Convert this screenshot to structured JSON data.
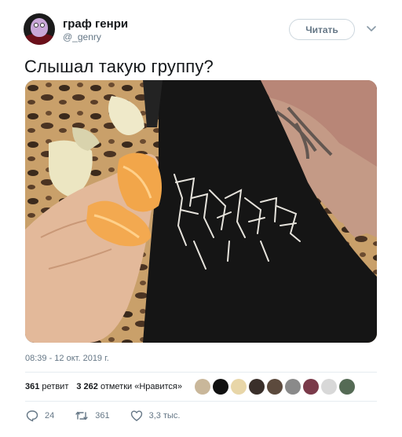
{
  "author": {
    "display_name": "граф генри",
    "handle": "@_genry"
  },
  "follow_button_label": "Читать",
  "tweet_text": "Слышал такую группу?",
  "timestamp": "08:39 - 12 окт. 2019 г.",
  "stats": {
    "retweets_count": "361",
    "retweets_label": "ретвит",
    "likes_count": "3 262",
    "likes_label": "отметки «Нравится»"
  },
  "likers": [
    "#c9b79a",
    "#111111",
    "#e8d6a8",
    "#3a2f2a",
    "#5c4a3d",
    "#8a8a8a",
    "#7a3a4a",
    "#d8d8d8",
    "#556b55"
  ],
  "actions": {
    "replies": "24",
    "retweets": "361",
    "likes": "3,3 тыс."
  },
  "icons": {
    "reply": "reply-icon",
    "retweet": "retweet-icon",
    "like": "heart-icon",
    "caret": "chevron-down-icon"
  }
}
